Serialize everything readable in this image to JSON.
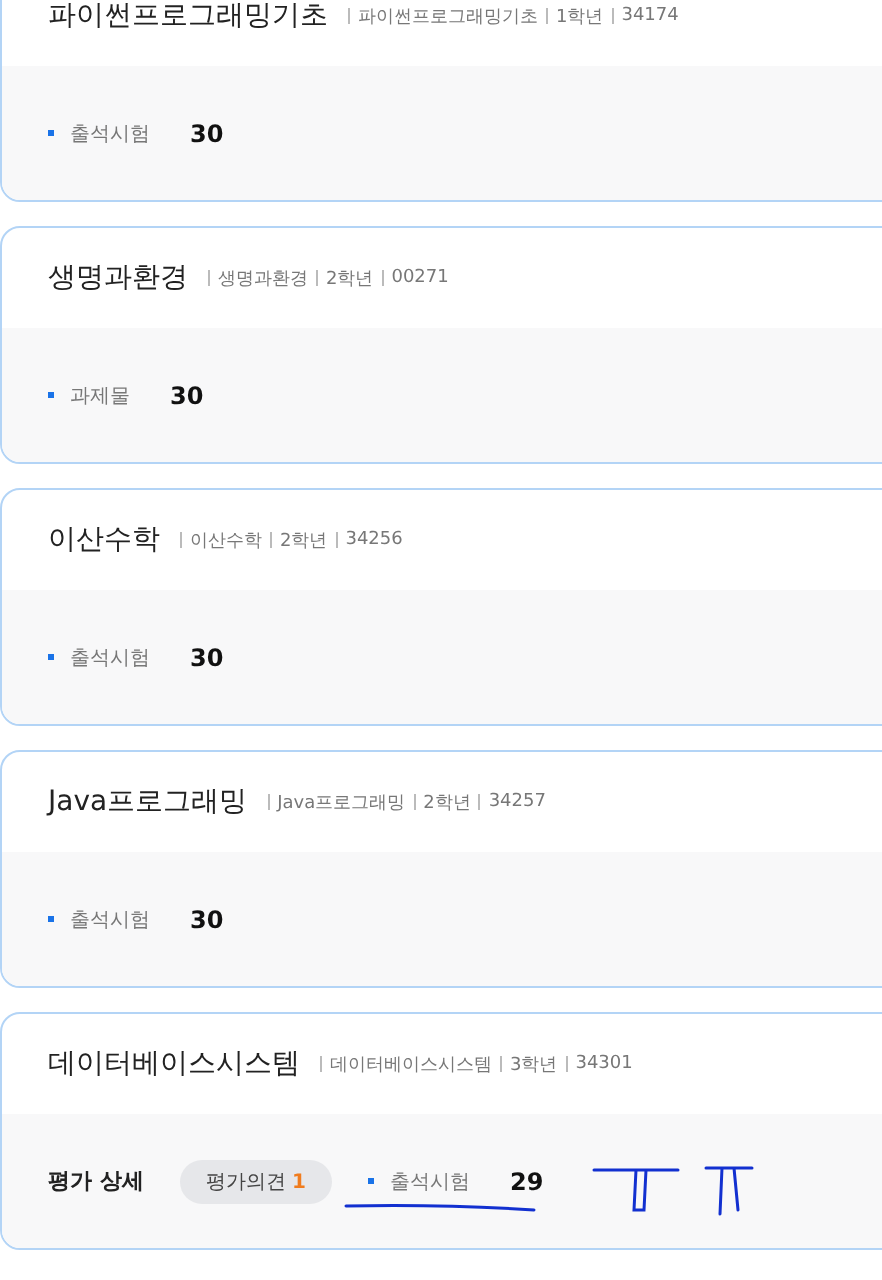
{
  "courses": [
    {
      "title": "파이썬프로그래밍기초",
      "meta": [
        "파이썬프로그래밍기초",
        "1학년",
        "34174"
      ],
      "items": [
        {
          "label": "출석시험",
          "value": "30"
        }
      ]
    },
    {
      "title": "생명과환경",
      "meta": [
        "생명과환경",
        "2학년",
        "00271"
      ],
      "items": [
        {
          "label": "과제물",
          "value": "30"
        }
      ]
    },
    {
      "title": "이산수학",
      "meta": [
        "이산수학",
        "2학년",
        "34256"
      ],
      "items": [
        {
          "label": "출석시험",
          "value": "30"
        }
      ]
    },
    {
      "title": "Java프로그래밍",
      "meta": [
        "Java프로그래밍",
        "2학년",
        "34257"
      ],
      "items": [
        {
          "label": "출석시험",
          "value": "30"
        }
      ]
    },
    {
      "title": "데이터베이스시스템",
      "meta": [
        "데이터베이스시스템",
        "3학년",
        "34301"
      ],
      "detail": {
        "label": "평가 상세",
        "badge": "평가의견",
        "count": "1"
      },
      "items": [
        {
          "label": "출석시험",
          "value": "29"
        }
      ]
    }
  ]
}
